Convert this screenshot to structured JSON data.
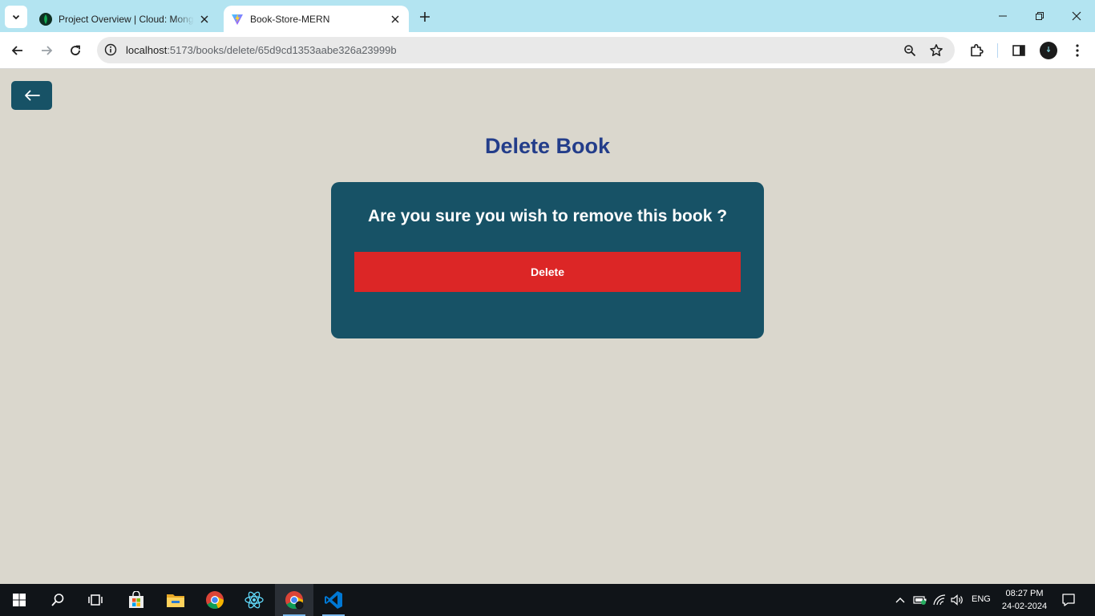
{
  "browser": {
    "tabs": [
      {
        "title": "Project Overview | Cloud: MongoDB Cloud",
        "favicon": "mongodb-leaf-icon",
        "active": false
      },
      {
        "title": "Book-Store-MERN",
        "favicon": "vite-logo-icon",
        "active": true
      }
    ],
    "address_bar": {
      "host": "localhost",
      "path": ":5173/books/delete/65d9cd1353aabe326a23999b"
    }
  },
  "page": {
    "title": "Delete Book",
    "confirm_question": "Are you sure you wish to remove this book ?",
    "delete_label": "Delete",
    "back_icon": "arrow-left-icon"
  },
  "colors": {
    "page_background": "#dad7cd",
    "accent_dark": "#175266",
    "title_color": "#233d8a",
    "danger": "#dc2626",
    "tabstrip": "#b3e4f1"
  },
  "taskbar": {
    "apps": [
      "windows-start-icon",
      "search-icon",
      "task-view-icon",
      "microsoft-store-icon",
      "file-explorer-icon",
      "chrome-icon",
      "react-icon",
      "chrome-active-icon",
      "vscode-icon"
    ],
    "language": "ENG",
    "time": "08:27 PM",
    "date": "24-02-2024"
  }
}
